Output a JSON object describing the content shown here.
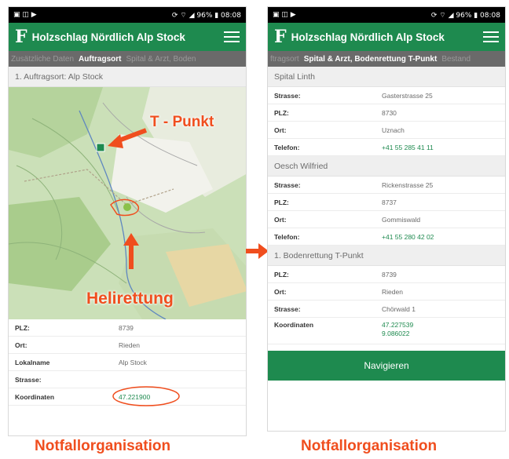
{
  "left_phone": {
    "status": {
      "left_icons": "▣ ◫ ▶",
      "right": "⟳ ⌔ ◢ 96% ▮ 08:08"
    },
    "app": {
      "logo": "F",
      "title": "Holzschlag Nördlich Alp Stock"
    },
    "tabs": [
      "Zusätzliche Daten",
      "Auftragsort",
      "Spital & Arzt, Boden"
    ],
    "active_tab": "Auftragsort",
    "section_title": "1. Auftragsort: Alp Stock",
    "annotations": {
      "t_punkt": "T - Punkt",
      "heli": "Helirettung"
    },
    "details": [
      {
        "label": "PLZ:",
        "value": "8739"
      },
      {
        "label": "Ort:",
        "value": "Rieden"
      },
      {
        "label": "Lokalname",
        "value": "Alp Stock"
      },
      {
        "label": "Strasse:",
        "value": ""
      },
      {
        "label": "Koordinaten",
        "value": "47.221900"
      }
    ]
  },
  "right_phone": {
    "status": {
      "left_icons": "▣ ◫ ▶",
      "right": "⟳ ⌔ ◢ 96% ▮ 08:08"
    },
    "app": {
      "logo": "F",
      "title": "Holzschlag Nördlich Alp Stock"
    },
    "tabs": [
      "ftragsort",
      "Spital & Arzt, Bodenrettung T-Punkt",
      "Bestand"
    ],
    "active_tab": "Spital & Arzt, Bodenrettung T-Punkt",
    "sections": [
      {
        "title": "Spital Linth",
        "rows": [
          {
            "label": "Strasse:",
            "value": "Gasterstrasse 25"
          },
          {
            "label": "PLZ:",
            "value": "8730"
          },
          {
            "label": "Ort:",
            "value": "Uznach"
          },
          {
            "label": "Telefon:",
            "value": "+41 55 285 41 11"
          }
        ]
      },
      {
        "title": "Oesch Wilfried",
        "rows": [
          {
            "label": "Strasse:",
            "value": "Rickenstrasse 25"
          },
          {
            "label": "PLZ:",
            "value": "8737"
          },
          {
            "label": "Ort:",
            "value": "Gommiswald"
          },
          {
            "label": "Telefon:",
            "value": "+41 55 280 42 02"
          }
        ]
      },
      {
        "title": "1. Bodenrettung T-Punkt",
        "rows": [
          {
            "label": "PLZ:",
            "value": "8739"
          },
          {
            "label": "Ort:",
            "value": "Rieden"
          },
          {
            "label": "Strasse:",
            "value": "Chörwald 1"
          },
          {
            "label": "Koordinaten",
            "value": "47.227539\n9.086022"
          }
        ]
      }
    ],
    "button": "Navigieren"
  },
  "captions": {
    "left": "Notfallorganisation",
    "right": "Notfallorganisation"
  },
  "colors": {
    "green": "#1e8a4f",
    "accent": "#f04e1e",
    "tab_bar": "#6a6a6a"
  }
}
